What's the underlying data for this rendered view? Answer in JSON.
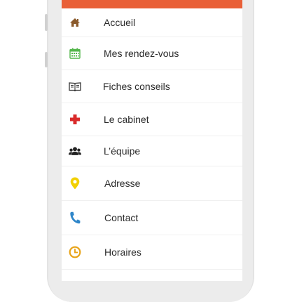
{
  "colors": {
    "header": "#e95f37",
    "home": "#8a5a2b",
    "calendar": "#53b64a",
    "book": "#333333",
    "cross": "#d92b2b",
    "team": "#222222",
    "pin": "#f2d000",
    "phone": "#2f86c9",
    "clock": "#e8a317"
  },
  "menu": {
    "items": [
      {
        "label": "Accueil",
        "icon": "home-icon"
      },
      {
        "label": "Mes rendez-vous",
        "icon": "calendar-icon"
      },
      {
        "label": "Fiches conseils",
        "icon": "book-icon"
      },
      {
        "label": "Le cabinet",
        "icon": "medical-cross-icon"
      },
      {
        "label": "L’équipe",
        "icon": "team-icon"
      },
      {
        "label": "Adresse",
        "icon": "map-pin-icon"
      },
      {
        "label": "Contact",
        "icon": "phone-icon"
      },
      {
        "label": "Horaires",
        "icon": "clock-icon"
      }
    ]
  }
}
